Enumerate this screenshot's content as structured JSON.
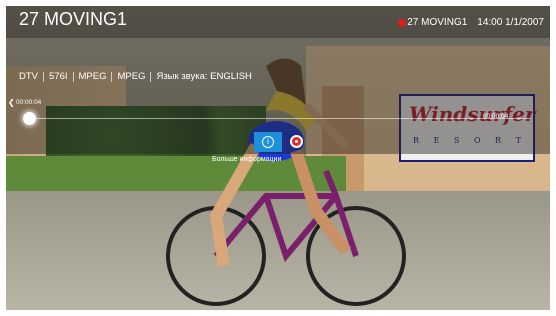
{
  "header": {
    "channel_title": "27  MOVING1",
    "recording_channel": "27 MOVING1",
    "clock": "14:00 1/1/2007"
  },
  "info_tags": [
    "DTV",
    "576I",
    "MPEG",
    "MPEG",
    "Язык звука: ENGLISH"
  ],
  "playback": {
    "current_time": "00:00:04",
    "end_time": "00:00:04",
    "position_fraction": 0.0
  },
  "controls": {
    "info_icon": "info-icon",
    "record_icon": "record-icon",
    "info_label": "Больше информации"
  },
  "scene_sign": {
    "title": "Windsurfer",
    "subtitle": "R E S O R T"
  },
  "colors": {
    "accent": "#1f8fd9",
    "record": "#e01d1d"
  }
}
